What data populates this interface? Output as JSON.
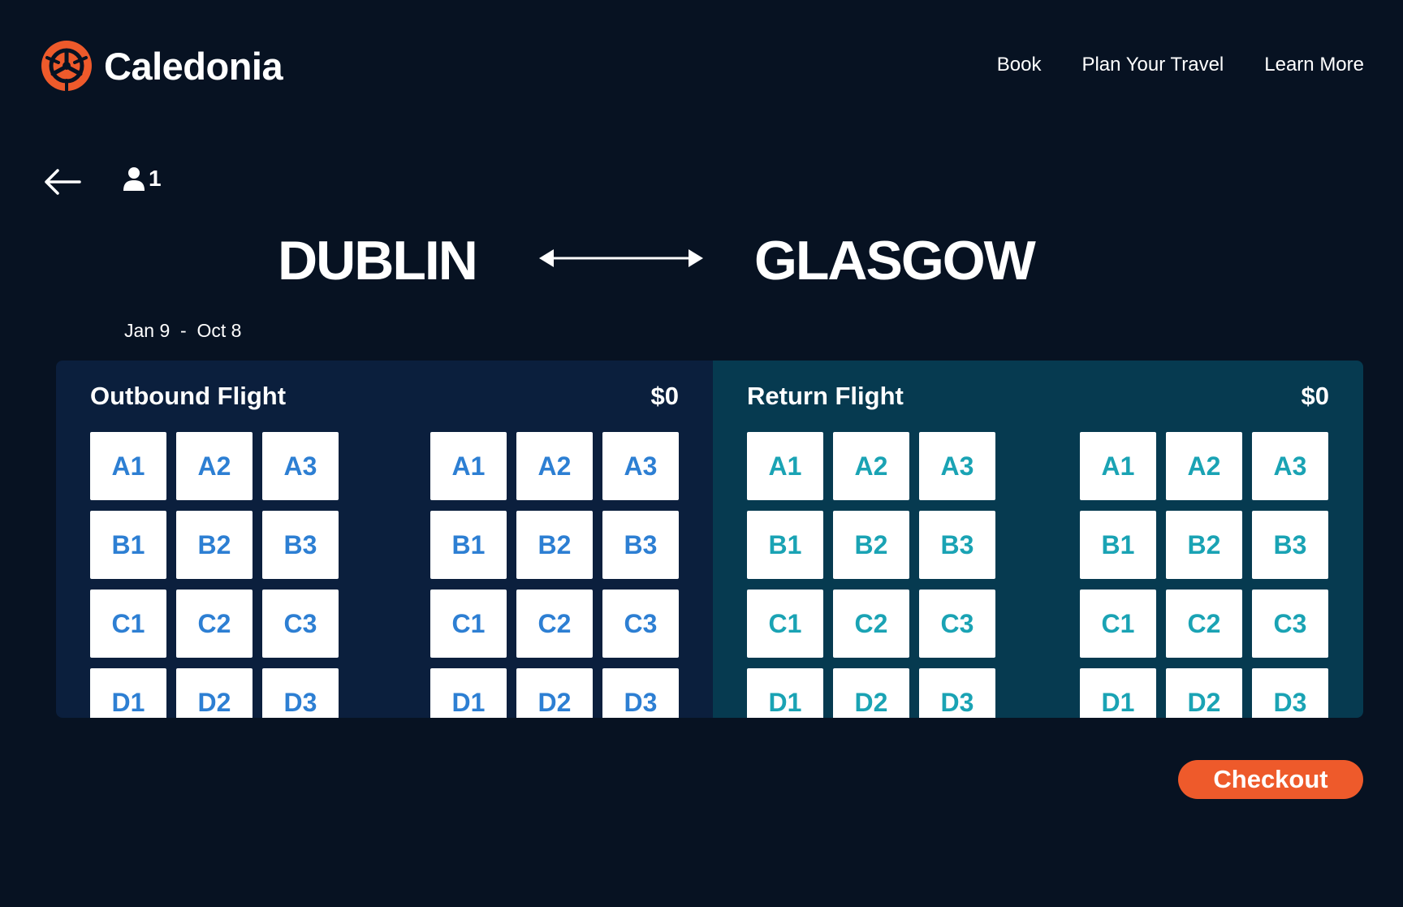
{
  "brand": {
    "name": "Caledonia",
    "accent": "#ee5a2b"
  },
  "nav": [
    {
      "label": "Book"
    },
    {
      "label": "Plan Your Travel"
    },
    {
      "label": "Learn More"
    }
  ],
  "trip": {
    "passengers": "1",
    "from": "DUBLIN",
    "to": "GLASGOW",
    "dates": "Jan 9  -  Oct 8"
  },
  "outbound": {
    "title": "Outbound Flight",
    "price": "$0",
    "seat_color": "#2d7fd3",
    "left_block": [
      "A1",
      "A2",
      "A3",
      "B1",
      "B2",
      "B3",
      "C1",
      "C2",
      "C3",
      "D1",
      "D2",
      "D3"
    ],
    "right_block": [
      "A1",
      "A2",
      "A3",
      "B1",
      "B2",
      "B3",
      "C1",
      "C2",
      "C3",
      "D1",
      "D2",
      "D3"
    ]
  },
  "return": {
    "title": "Return Flight",
    "price": "$0",
    "seat_color": "#1aa3b4",
    "left_block": [
      "A1",
      "A2",
      "A3",
      "B1",
      "B2",
      "B3",
      "C1",
      "C2",
      "C3",
      "D1",
      "D2",
      "D3"
    ],
    "right_block": [
      "A1",
      "A2",
      "A3",
      "B1",
      "B2",
      "B3",
      "C1",
      "C2",
      "C3",
      "D1",
      "D2",
      "D3"
    ]
  },
  "checkout": {
    "label": "Checkout"
  }
}
